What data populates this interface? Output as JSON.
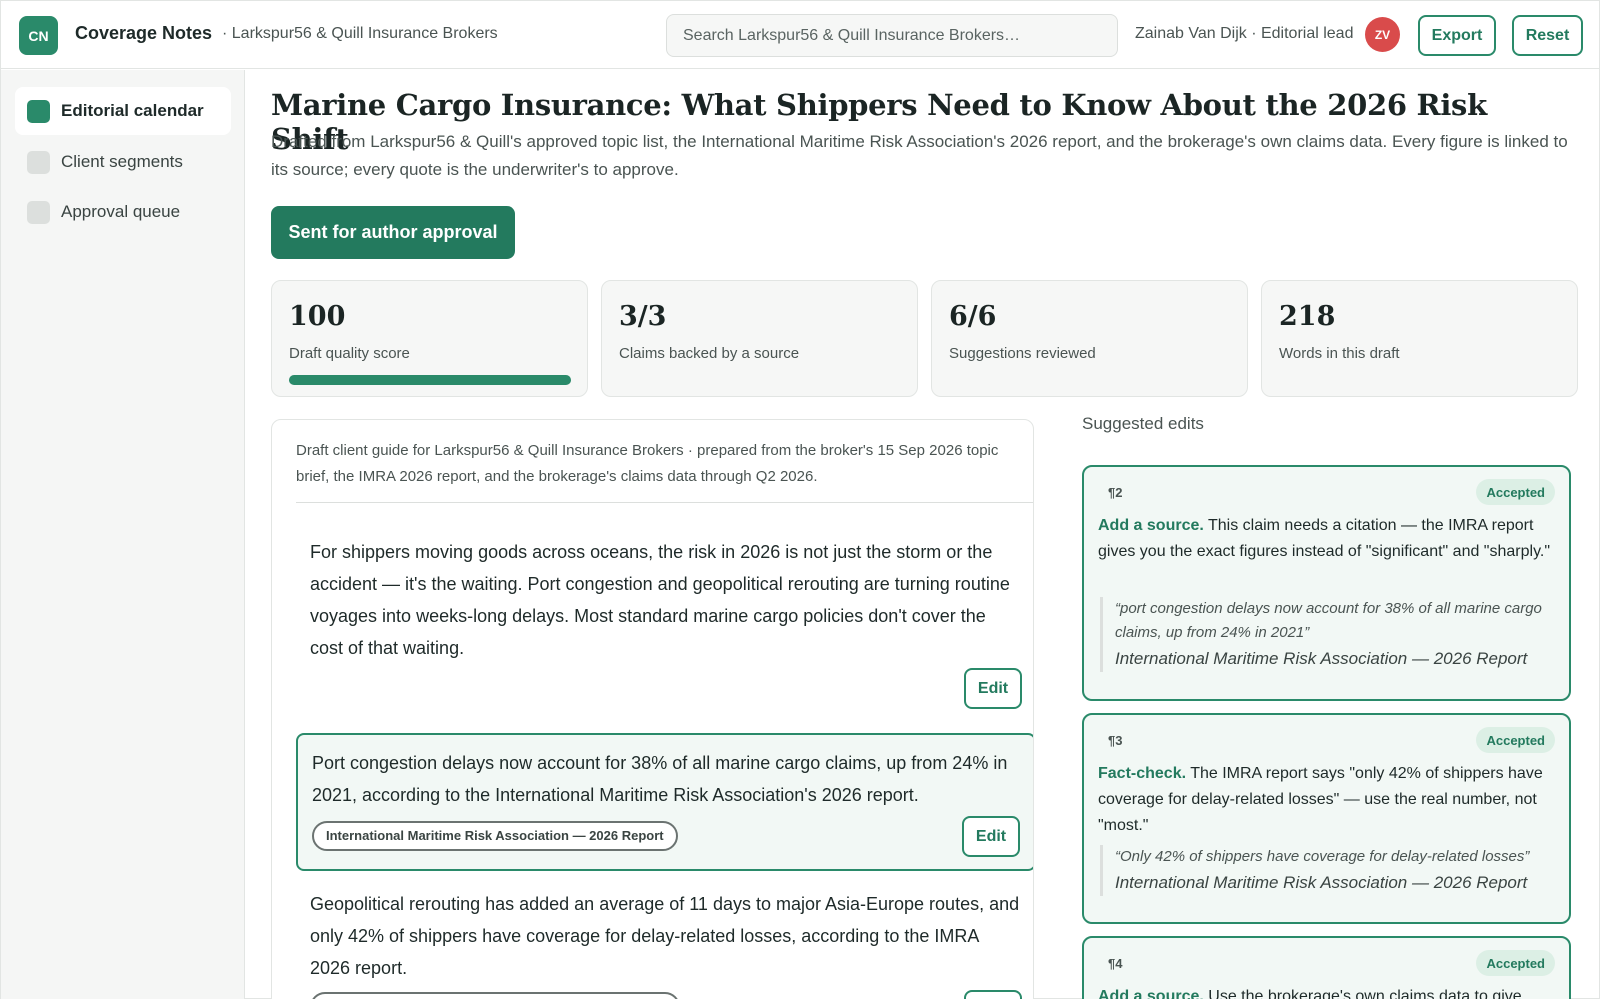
{
  "app": {
    "logo": "CN",
    "name": "Coverage Notes",
    "org": "· Larkspur56 & Quill Insurance Brokers"
  },
  "search": {
    "placeholder": "Search Larkspur56 & Quill Insurance Brokers…"
  },
  "user": {
    "label": "Zainab Van Dijk · Editorial lead",
    "initials": "ZV"
  },
  "toolbar": {
    "export_label": "Export",
    "reset_label": "Reset"
  },
  "sidebar": {
    "items": [
      {
        "label": "Editorial calendar",
        "active": true
      },
      {
        "label": "Client segments",
        "active": false
      },
      {
        "label": "Approval queue",
        "active": false
      }
    ]
  },
  "page": {
    "title": "Marine Cargo Insurance: What Shippers Need to Know About the 2026 Risk Shift",
    "subtitle": "Drafted from Larkspur56 & Quill's approved topic list, the International Maritime Risk Association's 2026 report, and the brokerage's own claims data. Every figure is linked to its source; every quote is the underwriter's to approve.",
    "status_button": "Sent for author approval"
  },
  "stats": [
    {
      "value": "100",
      "label": "Draft quality score",
      "progress": 1.0
    },
    {
      "value": "3/3",
      "label": "Claims backed by a source"
    },
    {
      "value": "6/6",
      "label": "Suggestions reviewed"
    },
    {
      "value": "218",
      "label": "Words in this draft"
    }
  ],
  "draft": {
    "intro": "Draft client guide for Larkspur56 & Quill Insurance Brokers · prepared from the broker's 15 Sep 2026 topic brief, the IMRA 2026 report, and the brokerage's claims data through Q2 2026.",
    "edit_label": "Edit",
    "paragraphs": [
      {
        "text": "For shippers moving goods across oceans, the risk in 2026 is not just the storm or the accident — it's the waiting. Port congestion and geopolitical rerouting are turning routine voyages into weeks-long delays. Most standard marine cargo policies don't cover the cost of that waiting."
      },
      {
        "text": "Port congestion delays now account for 38% of all marine cargo claims, up from 24% in 2021, according to the International Maritime Risk Association's 2026 report.",
        "source": "International Maritime Risk Association — 2026 Report"
      },
      {
        "text": "Geopolitical rerouting has added an average of 11 days to major Asia-Europe routes, and only 42% of shippers have coverage for delay-related losses, according to the IMRA 2026 report."
      }
    ]
  },
  "suggestions": {
    "heading": "Suggested edits",
    "items": [
      {
        "para": "¶2",
        "status": "Accepted",
        "kind": "Add a source.",
        "body": " This claim needs a citation — the IMRA report gives you the exact figures instead of \"significant\" and \"sharply.\"",
        "quote": "“port congestion delays now account for 38% of all marine cargo claims, up from 24% in 2021”",
        "source": "International Maritime Risk Association — 2026 Report"
      },
      {
        "para": "¶3",
        "status": "Accepted",
        "kind": "Fact-check.",
        "body": " The IMRA report says \"only 42% of shippers have coverage for delay-related losses\" — use the real number, not \"most.\"",
        "quote": "“Only 42% of shippers have coverage for delay-related losses”",
        "source": "International Maritime Risk Association — 2026 Report"
      },
      {
        "para": "¶4",
        "status": "Accepted",
        "kind": "Add a source.",
        "body": " Use the brokerage's own claims data to give"
      }
    ]
  },
  "colors": {
    "accent": "#2a8a6a",
    "accent_dark": "#237a5e",
    "avatar": "#d94b4b"
  }
}
